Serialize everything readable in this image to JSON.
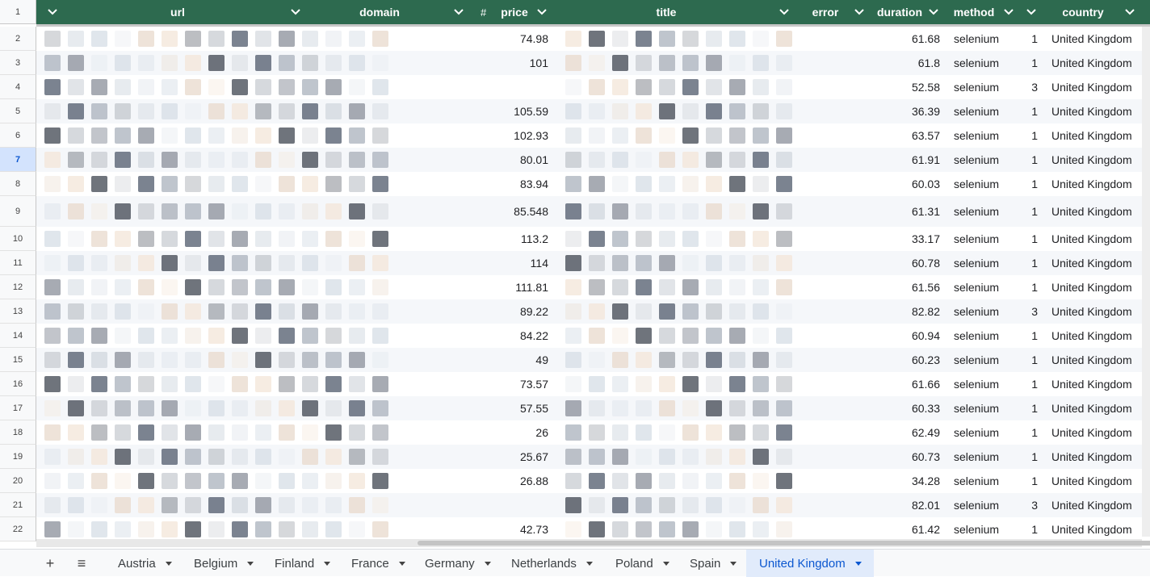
{
  "columns": {
    "row_header": "1",
    "url": "url",
    "domain": "domain",
    "price_prefix": "#",
    "price": "price",
    "title": "title",
    "error": "error",
    "duration": "duration",
    "method": "method",
    "country": "country"
  },
  "rows": [
    {
      "num": "2",
      "price": "74.98",
      "duration": "61.68",
      "method": "selenium",
      "attempts": "1",
      "country": "United Kingdom"
    },
    {
      "num": "3",
      "price": "101",
      "duration": "61.8",
      "method": "selenium",
      "attempts": "1",
      "country": "United Kingdom"
    },
    {
      "num": "4",
      "price": "",
      "duration": "52.58",
      "method": "selenium",
      "attempts": "3",
      "country": "United Kingdom"
    },
    {
      "num": "5",
      "price": "105.59",
      "duration": "36.39",
      "method": "selenium",
      "attempts": "1",
      "country": "United Kingdom"
    },
    {
      "num": "6",
      "price": "102.93",
      "duration": "63.57",
      "method": "selenium",
      "attempts": "1",
      "country": "United Kingdom"
    },
    {
      "num": "7",
      "price": "80.01",
      "duration": "61.91",
      "method": "selenium",
      "attempts": "1",
      "country": "United Kingdom",
      "selected": true
    },
    {
      "num": "8",
      "price": "83.94",
      "duration": "60.03",
      "method": "selenium",
      "attempts": "1",
      "country": "United Kingdom"
    },
    {
      "num": "9",
      "price": "85.548",
      "duration": "61.31",
      "method": "selenium",
      "attempts": "1",
      "country": "United Kingdom"
    },
    {
      "num": "10",
      "price": "113.2",
      "duration": "33.17",
      "method": "selenium",
      "attempts": "1",
      "country": "United Kingdom"
    },
    {
      "num": "11",
      "price": "114",
      "duration": "60.78",
      "method": "selenium",
      "attempts": "1",
      "country": "United Kingdom"
    },
    {
      "num": "12",
      "price": "111.81",
      "duration": "61.56",
      "method": "selenium",
      "attempts": "1",
      "country": "United Kingdom"
    },
    {
      "num": "13",
      "price": "89.22",
      "duration": "82.82",
      "method": "selenium",
      "attempts": "3",
      "country": "United Kingdom"
    },
    {
      "num": "14",
      "price": "84.22",
      "duration": "60.94",
      "method": "selenium",
      "attempts": "1",
      "country": "United Kingdom"
    },
    {
      "num": "15",
      "price": "49",
      "duration": "60.23",
      "method": "selenium",
      "attempts": "1",
      "country": "United Kingdom"
    },
    {
      "num": "16",
      "price": "73.57",
      "duration": "61.66",
      "method": "selenium",
      "attempts": "1",
      "country": "United Kingdom"
    },
    {
      "num": "17",
      "price": "57.55",
      "duration": "60.33",
      "method": "selenium",
      "attempts": "1",
      "country": "United Kingdom"
    },
    {
      "num": "18",
      "price": "26",
      "duration": "62.49",
      "method": "selenium",
      "attempts": "1",
      "country": "United Kingdom"
    },
    {
      "num": "19",
      "price": "25.67",
      "duration": "60.73",
      "method": "selenium",
      "attempts": "1",
      "country": "United Kingdom"
    },
    {
      "num": "20",
      "price": "26.88",
      "duration": "34.28",
      "method": "selenium",
      "attempts": "1",
      "country": "United Kingdom"
    },
    {
      "num": "21",
      "price": "",
      "duration": "82.01",
      "method": "selenium",
      "attempts": "3",
      "country": "United Kingdom"
    },
    {
      "num": "22",
      "price": "42.73",
      "duration": "61.42",
      "method": "selenium",
      "attempts": "1",
      "country": "United Kingdom"
    }
  ],
  "sheet_tabs": [
    "Austria",
    "Belgium",
    "Finland",
    "France",
    "Germany",
    "Netherlands",
    "Poland",
    "Spain",
    "United Kingdom"
  ],
  "active_tab": "United Kingdom",
  "tab_buttons": {
    "add": "+",
    "all_sheets": "≡"
  },
  "colors": {
    "header_bg": "#2d6a4f",
    "active_tab_bg": "#e1ebfb",
    "active_tab_text": "#0b57d0"
  }
}
